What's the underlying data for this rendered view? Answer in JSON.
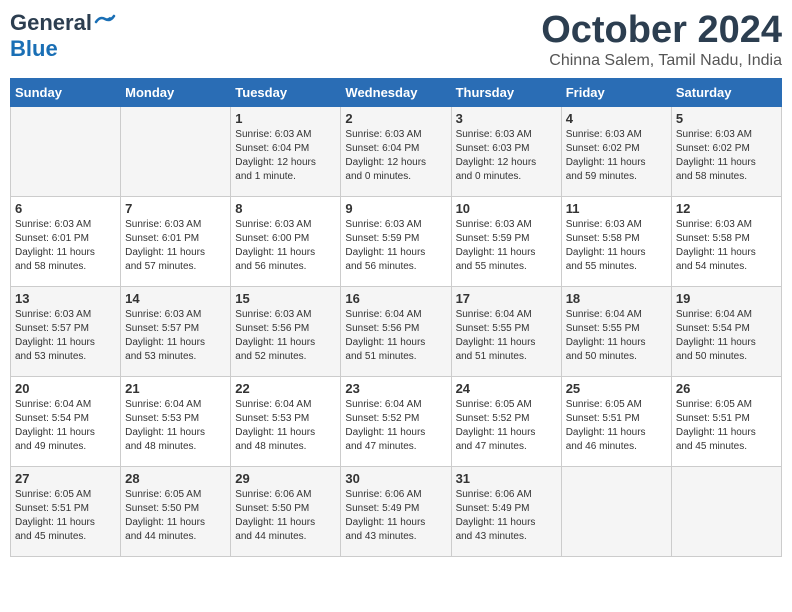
{
  "header": {
    "logo_line1": "General",
    "logo_line2": "Blue",
    "month": "October 2024",
    "location": "Chinna Salem, Tamil Nadu, India"
  },
  "days_of_week": [
    "Sunday",
    "Monday",
    "Tuesday",
    "Wednesday",
    "Thursday",
    "Friday",
    "Saturday"
  ],
  "weeks": [
    [
      {
        "day": "",
        "info": ""
      },
      {
        "day": "",
        "info": ""
      },
      {
        "day": "1",
        "info": "Sunrise: 6:03 AM\nSunset: 6:04 PM\nDaylight: 12 hours\nand 1 minute."
      },
      {
        "day": "2",
        "info": "Sunrise: 6:03 AM\nSunset: 6:04 PM\nDaylight: 12 hours\nand 0 minutes."
      },
      {
        "day": "3",
        "info": "Sunrise: 6:03 AM\nSunset: 6:03 PM\nDaylight: 12 hours\nand 0 minutes."
      },
      {
        "day": "4",
        "info": "Sunrise: 6:03 AM\nSunset: 6:02 PM\nDaylight: 11 hours\nand 59 minutes."
      },
      {
        "day": "5",
        "info": "Sunrise: 6:03 AM\nSunset: 6:02 PM\nDaylight: 11 hours\nand 58 minutes."
      }
    ],
    [
      {
        "day": "6",
        "info": "Sunrise: 6:03 AM\nSunset: 6:01 PM\nDaylight: 11 hours\nand 58 minutes."
      },
      {
        "day": "7",
        "info": "Sunrise: 6:03 AM\nSunset: 6:01 PM\nDaylight: 11 hours\nand 57 minutes."
      },
      {
        "day": "8",
        "info": "Sunrise: 6:03 AM\nSunset: 6:00 PM\nDaylight: 11 hours\nand 56 minutes."
      },
      {
        "day": "9",
        "info": "Sunrise: 6:03 AM\nSunset: 5:59 PM\nDaylight: 11 hours\nand 56 minutes."
      },
      {
        "day": "10",
        "info": "Sunrise: 6:03 AM\nSunset: 5:59 PM\nDaylight: 11 hours\nand 55 minutes."
      },
      {
        "day": "11",
        "info": "Sunrise: 6:03 AM\nSunset: 5:58 PM\nDaylight: 11 hours\nand 55 minutes."
      },
      {
        "day": "12",
        "info": "Sunrise: 6:03 AM\nSunset: 5:58 PM\nDaylight: 11 hours\nand 54 minutes."
      }
    ],
    [
      {
        "day": "13",
        "info": "Sunrise: 6:03 AM\nSunset: 5:57 PM\nDaylight: 11 hours\nand 53 minutes."
      },
      {
        "day": "14",
        "info": "Sunrise: 6:03 AM\nSunset: 5:57 PM\nDaylight: 11 hours\nand 53 minutes."
      },
      {
        "day": "15",
        "info": "Sunrise: 6:03 AM\nSunset: 5:56 PM\nDaylight: 11 hours\nand 52 minutes."
      },
      {
        "day": "16",
        "info": "Sunrise: 6:04 AM\nSunset: 5:56 PM\nDaylight: 11 hours\nand 51 minutes."
      },
      {
        "day": "17",
        "info": "Sunrise: 6:04 AM\nSunset: 5:55 PM\nDaylight: 11 hours\nand 51 minutes."
      },
      {
        "day": "18",
        "info": "Sunrise: 6:04 AM\nSunset: 5:55 PM\nDaylight: 11 hours\nand 50 minutes."
      },
      {
        "day": "19",
        "info": "Sunrise: 6:04 AM\nSunset: 5:54 PM\nDaylight: 11 hours\nand 50 minutes."
      }
    ],
    [
      {
        "day": "20",
        "info": "Sunrise: 6:04 AM\nSunset: 5:54 PM\nDaylight: 11 hours\nand 49 minutes."
      },
      {
        "day": "21",
        "info": "Sunrise: 6:04 AM\nSunset: 5:53 PM\nDaylight: 11 hours\nand 48 minutes."
      },
      {
        "day": "22",
        "info": "Sunrise: 6:04 AM\nSunset: 5:53 PM\nDaylight: 11 hours\nand 48 minutes."
      },
      {
        "day": "23",
        "info": "Sunrise: 6:04 AM\nSunset: 5:52 PM\nDaylight: 11 hours\nand 47 minutes."
      },
      {
        "day": "24",
        "info": "Sunrise: 6:05 AM\nSunset: 5:52 PM\nDaylight: 11 hours\nand 47 minutes."
      },
      {
        "day": "25",
        "info": "Sunrise: 6:05 AM\nSunset: 5:51 PM\nDaylight: 11 hours\nand 46 minutes."
      },
      {
        "day": "26",
        "info": "Sunrise: 6:05 AM\nSunset: 5:51 PM\nDaylight: 11 hours\nand 45 minutes."
      }
    ],
    [
      {
        "day": "27",
        "info": "Sunrise: 6:05 AM\nSunset: 5:51 PM\nDaylight: 11 hours\nand 45 minutes."
      },
      {
        "day": "28",
        "info": "Sunrise: 6:05 AM\nSunset: 5:50 PM\nDaylight: 11 hours\nand 44 minutes."
      },
      {
        "day": "29",
        "info": "Sunrise: 6:06 AM\nSunset: 5:50 PM\nDaylight: 11 hours\nand 44 minutes."
      },
      {
        "day": "30",
        "info": "Sunrise: 6:06 AM\nSunset: 5:49 PM\nDaylight: 11 hours\nand 43 minutes."
      },
      {
        "day": "31",
        "info": "Sunrise: 6:06 AM\nSunset: 5:49 PM\nDaylight: 11 hours\nand 43 minutes."
      },
      {
        "day": "",
        "info": ""
      },
      {
        "day": "",
        "info": ""
      }
    ]
  ]
}
